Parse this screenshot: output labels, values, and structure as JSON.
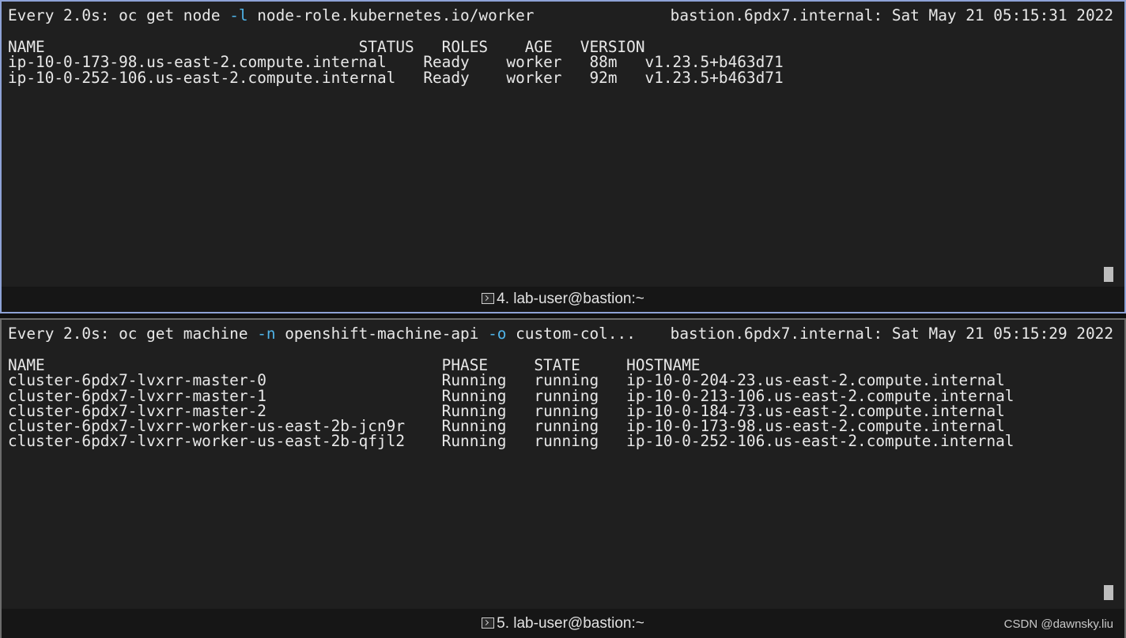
{
  "top_pane": {
    "cmd_prefix": "Every 2.0s: oc get node ",
    "cmd_flag": "-l",
    "cmd_rest": " node-role.kubernetes.io/worker",
    "timestamp": "bastion.6pdx7.internal: Sat May 21 05:15:31 2022",
    "columns": [
      "NAME",
      "STATUS",
      "ROLES",
      "AGE",
      "VERSION"
    ],
    "header_line": "NAME                                  STATUS   ROLES    AGE   VERSION",
    "rows": [
      {
        "name": "ip-10-0-173-98.us-east-2.compute.internal",
        "status": "Ready",
        "roles": "worker",
        "age": "88m",
        "version": "v1.23.5+b463d71"
      },
      {
        "name": "ip-10-0-252-106.us-east-2.compute.internal",
        "status": "Ready",
        "roles": "worker",
        "age": "92m",
        "version": "v1.23.5+b463d71"
      }
    ],
    "row_lines": [
      "ip-10-0-173-98.us-east-2.compute.internal    Ready    worker   88m   v1.23.5+b463d71",
      "ip-10-0-252-106.us-east-2.compute.internal   Ready    worker   92m   v1.23.5+b463d71"
    ],
    "tab_label": "4. lab-user@bastion:~"
  },
  "bottom_pane": {
    "cmd_prefix": "Every 2.0s: oc get machine ",
    "cmd_flag_n": "-n",
    "cmd_mid": " openshift-machine-api ",
    "cmd_flag_o": "-o",
    "cmd_rest": " custom-col...",
    "timestamp": "bastion.6pdx7.internal: Sat May 21 05:15:29 2022",
    "columns": [
      "NAME",
      "PHASE",
      "STATE",
      "HOSTNAME"
    ],
    "header_line": "NAME                                           PHASE     STATE     HOSTNAME",
    "rows": [
      {
        "name": "cluster-6pdx7-lvxrr-master-0",
        "phase": "Running",
        "state": "running",
        "hostname": "ip-10-0-204-23.us-east-2.compute.internal"
      },
      {
        "name": "cluster-6pdx7-lvxrr-master-1",
        "phase": "Running",
        "state": "running",
        "hostname": "ip-10-0-213-106.us-east-2.compute.internal"
      },
      {
        "name": "cluster-6pdx7-lvxrr-master-2",
        "phase": "Running",
        "state": "running",
        "hostname": "ip-10-0-184-73.us-east-2.compute.internal"
      },
      {
        "name": "cluster-6pdx7-lvxrr-worker-us-east-2b-jcn9r",
        "phase": "Running",
        "state": "running",
        "hostname": "ip-10-0-173-98.us-east-2.compute.internal"
      },
      {
        "name": "cluster-6pdx7-lvxrr-worker-us-east-2b-qfjl2",
        "phase": "Running",
        "state": "running",
        "hostname": "ip-10-0-252-106.us-east-2.compute.internal"
      }
    ],
    "row_lines": [
      "cluster-6pdx7-lvxrr-master-0                   Running   running   ip-10-0-204-23.us-east-2.compute.internal",
      "cluster-6pdx7-lvxrr-master-1                   Running   running   ip-10-0-213-106.us-east-2.compute.internal",
      "cluster-6pdx7-lvxrr-master-2                   Running   running   ip-10-0-184-73.us-east-2.compute.internal",
      "cluster-6pdx7-lvxrr-worker-us-east-2b-jcn9r    Running   running   ip-10-0-173-98.us-east-2.compute.internal",
      "cluster-6pdx7-lvxrr-worker-us-east-2b-qfjl2    Running   running   ip-10-0-252-106.us-east-2.compute.internal"
    ],
    "tab_label": "5. lab-user@bastion:~"
  },
  "watermark": "CSDN @dawnsky.liu",
  "colors": {
    "background": "#1f1f1f",
    "text": "#e8e8e8",
    "option_flag": "#4fb3e8",
    "active_border": "#8ea2d6",
    "tabbar": "#161616"
  }
}
